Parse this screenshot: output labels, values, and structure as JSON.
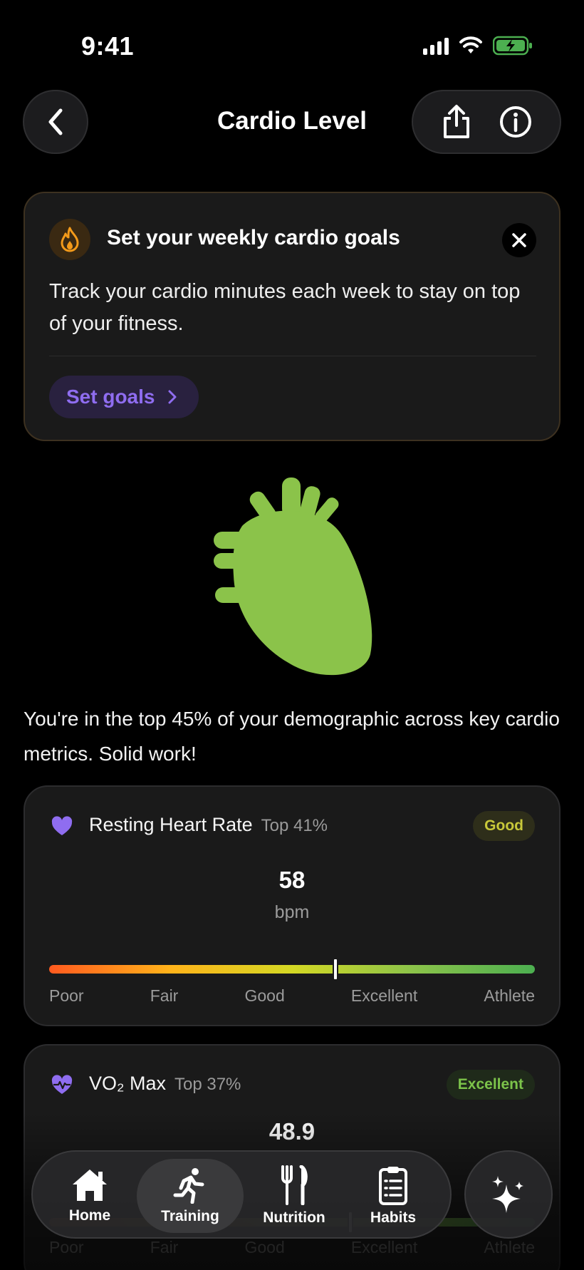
{
  "status_bar": {
    "time": "9:41",
    "icons": [
      "signal-icon",
      "wifi-icon",
      "battery-charging-icon"
    ]
  },
  "header": {
    "title": "Cardio Level",
    "back_icon": "chevron-left-icon",
    "share_icon": "share-icon",
    "info_icon": "info-icon"
  },
  "goal_card": {
    "title": "Set your weekly cardio goals",
    "body": "Track your cardio minutes each week to stay on top of your fitness.",
    "button_label": "Set goals",
    "icon": "flame-icon",
    "accent": "#8f6df0"
  },
  "summary": "You're in the top 45% of your demographic across key cardio metrics. Solid work!",
  "metrics": [
    {
      "name": "Resting Heart Rate",
      "percentile": "Top 41%",
      "badge": "Good",
      "value": "58",
      "unit": "bpm",
      "level_fraction": 0.59,
      "scale": [
        "Poor",
        "Fair",
        "Good",
        "Excellent",
        "Athlete"
      ],
      "icon": "heart-icon",
      "badge_color": "#c8c83a"
    },
    {
      "name": "VO₂ Max",
      "percentile": "Top 37%",
      "badge": "Excellent",
      "value": "48.9",
      "unit": "",
      "level_fraction": 0.62,
      "scale": [
        "Poor",
        "Fair",
        "Good",
        "Excellent",
        "Athlete"
      ],
      "icon": "heart-pulse-icon",
      "badge_color": "#7cc34a"
    }
  ],
  "tabs": [
    {
      "label": "Home",
      "icon": "home-icon",
      "active": false
    },
    {
      "label": "Training",
      "icon": "running-icon",
      "active": true
    },
    {
      "label": "Nutrition",
      "icon": "fork-knife-icon",
      "active": false
    },
    {
      "label": "Habits",
      "icon": "clipboard-icon",
      "active": false
    }
  ],
  "ai_button_icon": "sparkles-icon",
  "colors": {
    "heart": "#8bc34a",
    "accent_purple": "#8f6df0",
    "background": "#000000"
  }
}
